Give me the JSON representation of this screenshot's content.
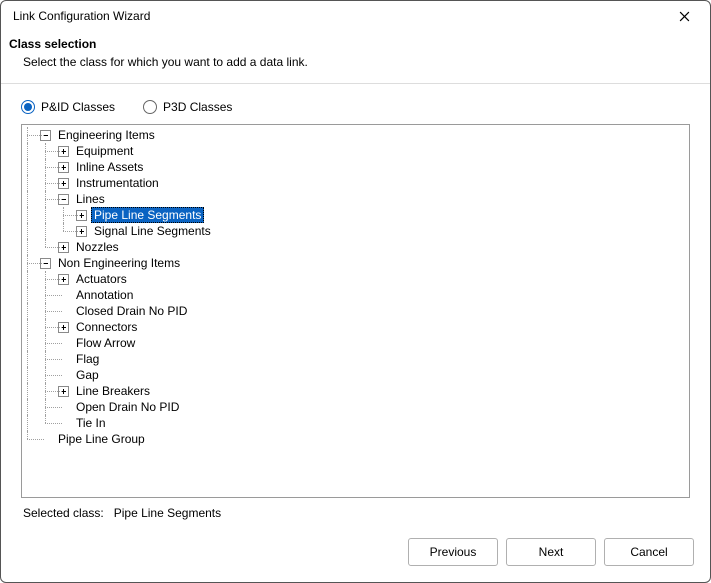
{
  "window": {
    "title": "Link Configuration Wizard"
  },
  "header": {
    "title": "Class selection",
    "subtitle": "Select the class for which you want to add a data link."
  },
  "radios": {
    "pidc": "P&ID Classes",
    "p3dc": "P3D Classes",
    "selected": "pidc"
  },
  "tree": {
    "engineering_items": "Engineering Items",
    "equipment": "Equipment",
    "inline_assets": "Inline Assets",
    "instrumentation": "Instrumentation",
    "lines": "Lines",
    "pipe_line_segments": "Pipe Line Segments",
    "signal_line_segments": "Signal Line Segments",
    "nozzles": "Nozzles",
    "non_engineering_items": "Non Engineering Items",
    "actuators": "Actuators",
    "annotation": "Annotation",
    "closed_drain_no_pid": "Closed Drain No PID",
    "connectors": "Connectors",
    "flow_arrow": "Flow Arrow",
    "flag": "Flag",
    "gap": "Gap",
    "line_breakers": "Line Breakers",
    "open_drain_no_pid": "Open Drain No PID",
    "tie_in": "Tie In",
    "pipe_line_group": "Pipe Line Group"
  },
  "selected": {
    "label": "Selected class:",
    "value": "Pipe Line Segments"
  },
  "buttons": {
    "previous": "Previous",
    "next": "Next",
    "cancel": "Cancel"
  }
}
